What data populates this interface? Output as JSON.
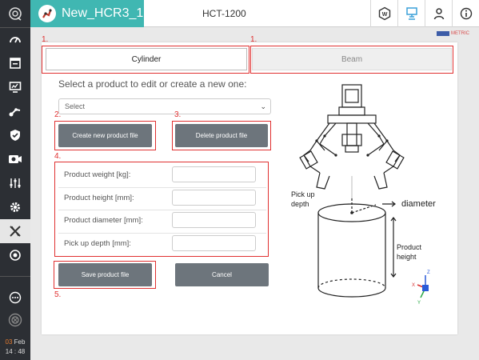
{
  "app": {
    "name": "New_HCR3_1",
    "device_title": "HCT-1200"
  },
  "header": {
    "buttons": [
      "workcell-icon",
      "robot-monitor-icon",
      "user-icon",
      "info-icon"
    ],
    "metric_label": "METRIC"
  },
  "sidebar": {
    "items": [
      "dashboard-icon",
      "program-icon",
      "monitor-icon",
      "setup-icon",
      "safety-icon",
      "camera-icon",
      "io-icon",
      "settings-icon",
      "extension-icon",
      "tool-icon"
    ],
    "active": "extension-icon",
    "bottom": [
      "chat-icon",
      "emergency-icon"
    ],
    "date_day": "03",
    "date_month": "Feb",
    "time": "14 : 48"
  },
  "tabs": [
    {
      "label": "Cylinder",
      "selected": true
    },
    {
      "label": "Beam",
      "selected": false
    }
  ],
  "annotations": [
    "1.",
    "1.",
    "2.",
    "3.",
    "4.",
    "5."
  ],
  "prompt": "Select a product to edit or create a new one:",
  "select": {
    "placeholder": "Select"
  },
  "buttons": {
    "create": "Create new product file",
    "delete": "Delete product file",
    "save": "Save product file",
    "cancel": "Cancel"
  },
  "fields": [
    {
      "label": "Product weight [kg]:",
      "value": ""
    },
    {
      "label": "Product height [mm]:",
      "value": ""
    },
    {
      "label": "Product diameter [mm]:",
      "value": ""
    },
    {
      "label": "Pick up depth [mm]:",
      "value": ""
    }
  ],
  "diagram": {
    "pick_up_depth": [
      "Pick up",
      "depth"
    ],
    "diameter": "diameter",
    "product_height": [
      "Product",
      "height"
    ],
    "axes": {
      "z": "Z",
      "x": "X",
      "y": "Y"
    }
  },
  "colors": {
    "accent": "#40b7b2",
    "sidebar": "#2c2f34",
    "button": "#6d757c",
    "annotation": "#e03030"
  }
}
